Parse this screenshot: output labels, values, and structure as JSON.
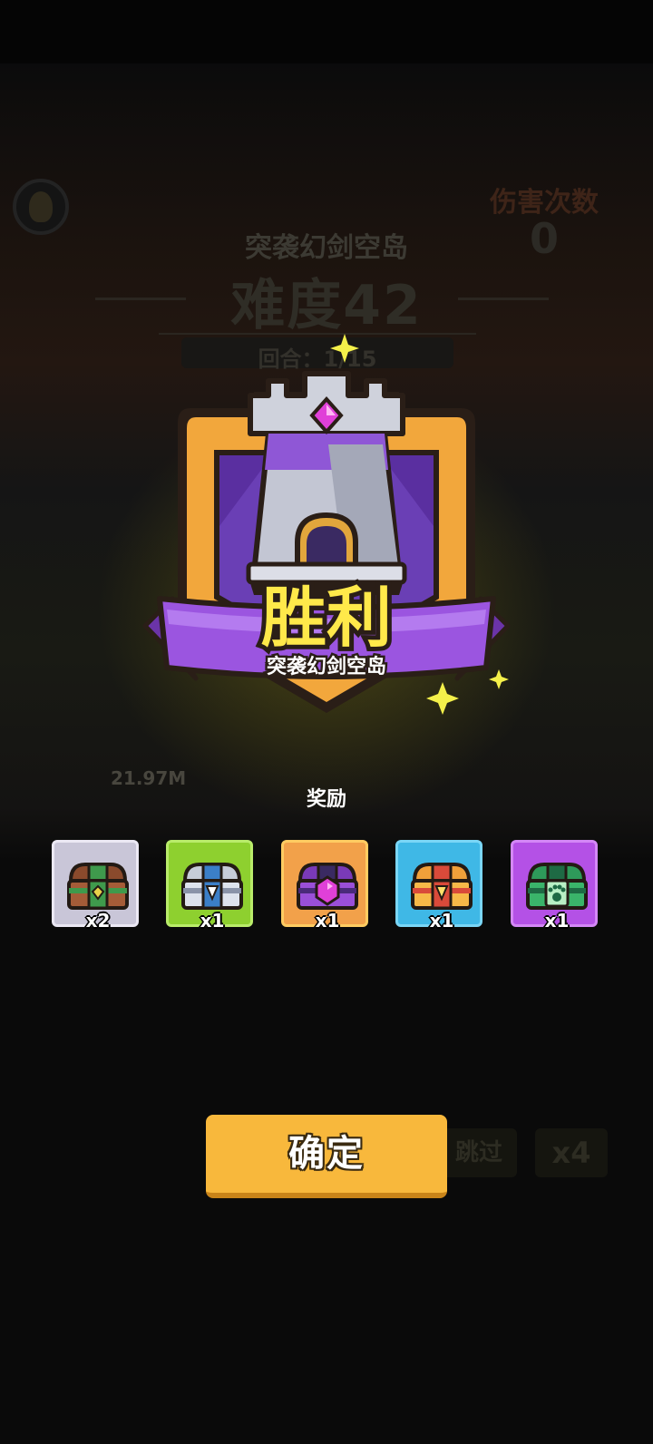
{
  "background": {
    "stage_title": "突袭幻剑空岛",
    "difficulty": "难度42",
    "round_text": "回合：1/15",
    "hit_count_label": "伤害次数",
    "hit_count_value": "0",
    "damage_value": "21.97M",
    "skip_label": "跳过",
    "speed_label": "x4"
  },
  "result": {
    "victory_label": "胜利",
    "stage_name": "突袭幻剑空岛"
  },
  "rewards": {
    "title": "奖励",
    "items": [
      {
        "icon": "brown-chest-icon",
        "count": "x2",
        "frame_color": "#c9c6d8"
      },
      {
        "icon": "silver-chest-icon",
        "count": "x1",
        "frame_color": "#8ed02f"
      },
      {
        "icon": "purple-gem-chest-icon",
        "count": "x1",
        "frame_color": "#f2a14a"
      },
      {
        "icon": "golden-chest-icon",
        "count": "x1",
        "frame_color": "#3fb8e6"
      },
      {
        "icon": "pet-paw-chest-icon",
        "count": "x1",
        "frame_color": "#b451e6"
      }
    ]
  },
  "confirm_label": "确定",
  "colors": {
    "accent_yellow": "#f8b83c",
    "ribbon_purple": "#9b55e0",
    "victory_text": "#ffe94a"
  }
}
